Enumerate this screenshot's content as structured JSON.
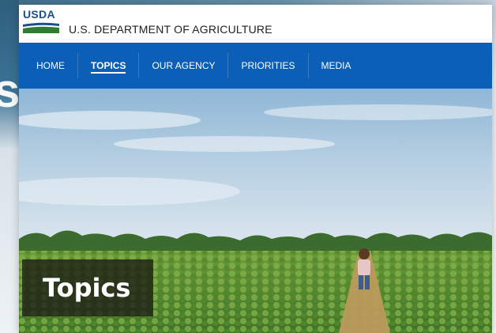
{
  "header": {
    "logo_text": "USDA",
    "department": "U.S. DEPARTMENT OF AGRICULTURE"
  },
  "nav": {
    "items": [
      {
        "label": "HOME"
      },
      {
        "label": "TOPICS",
        "active": true
      },
      {
        "label": "OUR AGENCY"
      },
      {
        "label": "PRIORITIES"
      },
      {
        "label": "MEDIA"
      }
    ]
  },
  "hero": {
    "title": "Topics"
  },
  "colors": {
    "nav_blue": "#0b5fb6",
    "logo_blue": "#1b4f8b",
    "logo_green": "#2f7d32"
  },
  "icons": {
    "logo": "usda-logo-icon"
  }
}
